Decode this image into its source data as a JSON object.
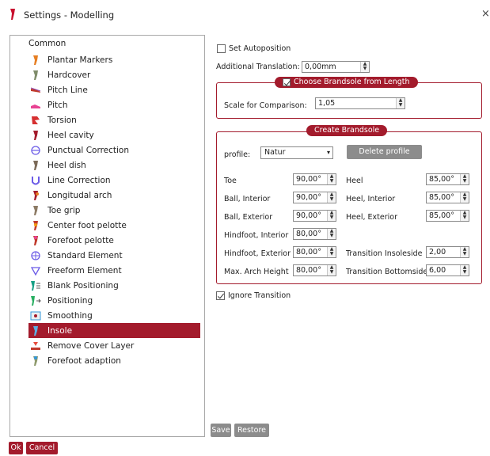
{
  "window": {
    "title": "Settings - Modelling",
    "close_glyph": "×"
  },
  "tree": {
    "group_label": "Common",
    "selected_index": 18,
    "items": [
      {
        "label": "Plantar Markers",
        "icon": "plantar-markers-icon"
      },
      {
        "label": "Hardcover",
        "icon": "hardcover-icon"
      },
      {
        "label": "Pitch Line",
        "icon": "pitch-line-icon"
      },
      {
        "label": "Pitch",
        "icon": "pitch-icon"
      },
      {
        "label": "Torsion",
        "icon": "torsion-icon"
      },
      {
        "label": "Heel cavity",
        "icon": "heel-cavity-icon"
      },
      {
        "label": "Punctual Correction",
        "icon": "punctual-correction-icon"
      },
      {
        "label": "Heel dish",
        "icon": "heel-dish-icon"
      },
      {
        "label": "Line Correction",
        "icon": "line-correction-icon"
      },
      {
        "label": "Longitudal arch",
        "icon": "longitudal-arch-icon"
      },
      {
        "label": "Toe grip",
        "icon": "toe-grip-icon"
      },
      {
        "label": "Center foot pelotte",
        "icon": "center-foot-pelotte-icon"
      },
      {
        "label": "Forefoot pelotte",
        "icon": "forefoot-pelotte-icon"
      },
      {
        "label": "Standard Element",
        "icon": "standard-element-icon"
      },
      {
        "label": "Freeform Element",
        "icon": "freeform-element-icon"
      },
      {
        "label": "Blank Positioning",
        "icon": "blank-positioning-icon"
      },
      {
        "label": "Positioning",
        "icon": "positioning-icon"
      },
      {
        "label": "Smoothing",
        "icon": "smoothing-icon"
      },
      {
        "label": "Insole",
        "icon": "insole-icon"
      },
      {
        "label": "Remove Cover Layer",
        "icon": "remove-cover-layer-icon"
      },
      {
        "label": "Forefoot adaption",
        "icon": "forefoot-adaption-icon"
      }
    ]
  },
  "settings": {
    "set_autoposition": {
      "label": "Set Autoposition",
      "checked": false
    },
    "additional_translation": {
      "label": "Additional Translation:",
      "value": "0,00mm"
    },
    "brandsole_from_length": {
      "title": "Choose Brandsole from Length",
      "checked": true,
      "scale_label": "Scale for Comparison:",
      "scale_value": "1,05"
    },
    "create_brandsole": {
      "title": "Create Brandsole",
      "profile_label": "profile:",
      "profile_value": "Natur",
      "delete_profile_label": "Delete profile",
      "fields": {
        "toe": {
          "label": "Toe",
          "value": "90,00°"
        },
        "heel": {
          "label": "Heel",
          "value": "85,00°"
        },
        "ball_interior": {
          "label": "Ball, Interior",
          "value": "90,00°"
        },
        "heel_interior": {
          "label": "Heel, Interior",
          "value": "85,00°"
        },
        "ball_exterior": {
          "label": "Ball, Exterior",
          "value": "90,00°"
        },
        "heel_exterior": {
          "label": "Heel, Exterior",
          "value": "85,00°"
        },
        "hindfoot_interior": {
          "label": "Hindfoot, Interior",
          "value": "80,00°"
        },
        "hindfoot_exterior": {
          "label": "Hindfoot, Exterior",
          "value": "80,00°"
        },
        "transition_insoleside": {
          "label": "Transition Insoleside",
          "value": "2,00"
        },
        "max_arch_height": {
          "label": "Max. Arch Height",
          "value": "80,00°"
        },
        "transition_bottomside": {
          "label": "Transition Bottomside",
          "value": "6,00"
        }
      }
    },
    "ignore_transition": {
      "label": "Ignore Transition",
      "checked": true
    }
  },
  "buttons": {
    "save": "Save",
    "restore": "Restore",
    "ok": "Ok",
    "cancel": "Cancel"
  },
  "spin_arrows": {
    "up": "▲",
    "down": "▼"
  },
  "dropdown_glyph": "▾",
  "colors": {
    "accent": "#a31b2c",
    "gray_button": "#8c8c8c",
    "tree_border": "#a8a8a8"
  }
}
